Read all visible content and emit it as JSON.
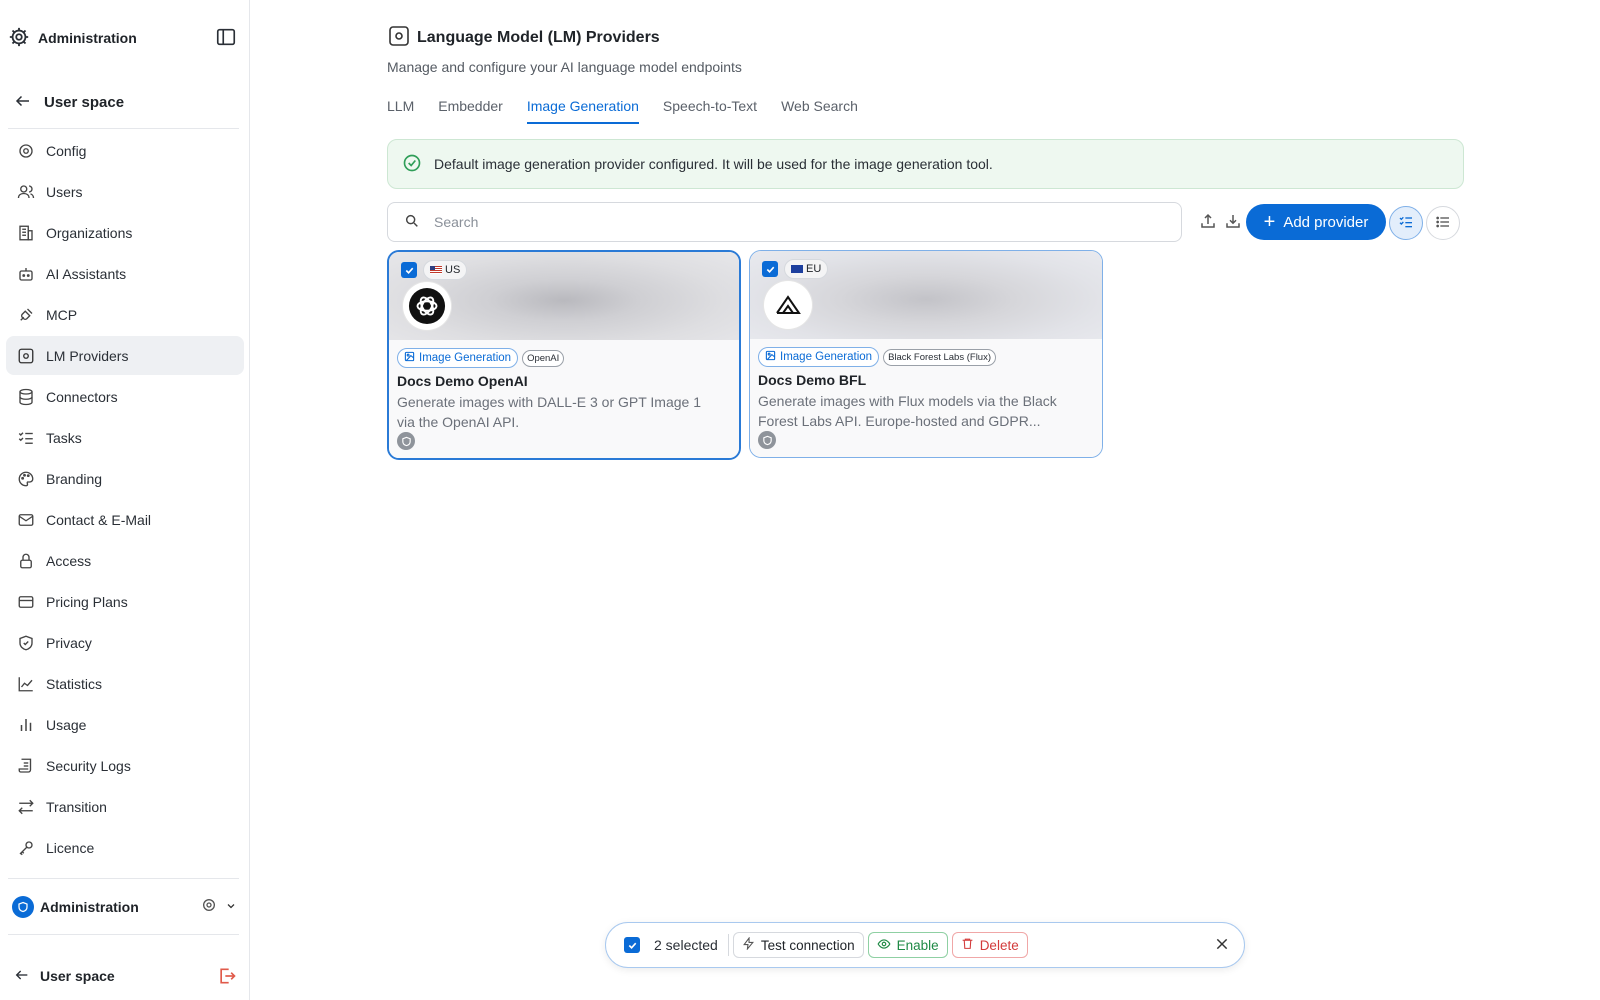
{
  "sidebar": {
    "title": "Administration",
    "back_label": "User space",
    "items": [
      {
        "label": "Config",
        "icon": "gear-icon",
        "active": false
      },
      {
        "label": "Users",
        "icon": "users-icon",
        "active": false
      },
      {
        "label": "Organizations",
        "icon": "building-icon",
        "active": false
      },
      {
        "label": "AI Assistants",
        "icon": "bot-icon",
        "active": false
      },
      {
        "label": "MCP",
        "icon": "plug-icon",
        "active": false
      },
      {
        "label": "LM Providers",
        "icon": "chip-icon",
        "active": true
      },
      {
        "label": "Connectors",
        "icon": "database-icon",
        "active": false
      },
      {
        "label": "Tasks",
        "icon": "list-check-icon",
        "active": false
      },
      {
        "label": "Branding",
        "icon": "palette-icon",
        "active": false
      },
      {
        "label": "Contact & E-Mail",
        "icon": "mail-icon",
        "active": false
      },
      {
        "label": "Access",
        "icon": "lock-icon",
        "active": false
      },
      {
        "label": "Pricing Plans",
        "icon": "credit-card-icon",
        "active": false
      },
      {
        "label": "Privacy",
        "icon": "shield-check-icon",
        "active": false
      },
      {
        "label": "Statistics",
        "icon": "chart-line-icon",
        "active": false
      },
      {
        "label": "Usage",
        "icon": "bar-chart-icon",
        "active": false
      },
      {
        "label": "Security Logs",
        "icon": "scroll-icon",
        "active": false
      },
      {
        "label": "Transition",
        "icon": "arrows-exchange-icon",
        "active": false
      },
      {
        "label": "Licence",
        "icon": "key-icon",
        "active": false
      }
    ],
    "org_label": "Administration",
    "bottom_label": "User space"
  },
  "header": {
    "title": "Language Model (LM) Providers",
    "subtitle": "Manage and configure your AI language model endpoints"
  },
  "tabs": [
    {
      "label": "LLM",
      "active": false
    },
    {
      "label": "Embedder",
      "active": false
    },
    {
      "label": "Image Generation",
      "active": true
    },
    {
      "label": "Speech-to-Text",
      "active": false
    },
    {
      "label": "Web Search",
      "active": false
    }
  ],
  "alert": {
    "text": "Default image generation provider configured. It will be used for the image generation tool."
  },
  "search": {
    "placeholder": "Search",
    "value": ""
  },
  "toolbar": {
    "add_label": "Add provider"
  },
  "cards": [
    {
      "region": "US",
      "type_tag": "Image Generation",
      "vendor_tag": "OpenAI",
      "title": "Docs Demo OpenAI",
      "description": "Generate images with DALL-E 3 or GPT Image 1 via the OpenAI API.",
      "checked": true
    },
    {
      "region": "EU",
      "type_tag": "Image Generation",
      "vendor_tag": "Black Forest Labs (Flux)",
      "title": "Docs Demo BFL",
      "description": "Generate images with Flux models via the Black Forest Labs API. Europe-hosted and GDPR...",
      "checked": true
    }
  ],
  "actionbar": {
    "selected_label": "2 selected",
    "test_label": "Test connection",
    "enable_label": "Enable",
    "delete_label": "Delete"
  },
  "colors": {
    "accent": "#0a6bd6",
    "success_bg": "#eef8f0",
    "delete": "#d33b3b",
    "enable": "#1f8a45"
  }
}
